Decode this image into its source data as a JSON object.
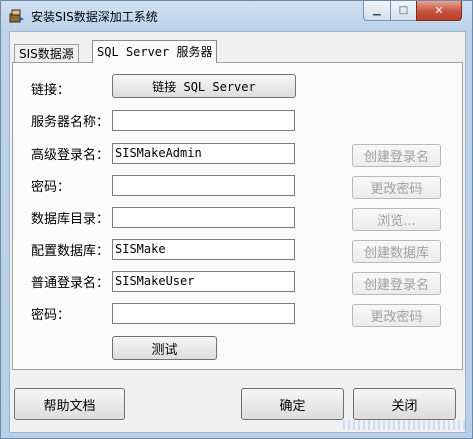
{
  "window": {
    "title": "安装SIS数据深加工系统",
    "minimize_glyph": "▁",
    "maximize_glyph": "□",
    "close_glyph": "✕"
  },
  "tabs": [
    {
      "label": "SIS数据源",
      "active": false
    },
    {
      "label": "SQL Server 服务器",
      "active": true
    }
  ],
  "form": {
    "link_label": "链接：",
    "link_button": "链接 SQL Server",
    "server_name_label": "服务器名称：",
    "server_name_value": "",
    "admin_login_label": "高级登录名：",
    "admin_login_value": "SISMakeAdmin",
    "admin_password_label": "密码：",
    "admin_password_value": "",
    "db_dir_label": "数据库目录：",
    "db_dir_value": "",
    "config_db_label": "配置数据库：",
    "config_db_value": "SISMake",
    "user_login_label": "普通登录名：",
    "user_login_value": "SISMakeUser",
    "user_password_label": "密码：",
    "user_password_value": "",
    "test_button": "测试"
  },
  "side_buttons": {
    "create_admin_login": "创建登录名",
    "change_admin_password": "更改密码",
    "browse": "浏览...",
    "create_database": "创建数据库",
    "create_user_login": "创建登录名",
    "change_user_password": "更改密码"
  },
  "footer": {
    "help_button": "帮助文档",
    "ok_button": "确定",
    "close_button": "关闭"
  },
  "icons": {
    "app": "installer-icon"
  },
  "colors": {
    "titlebar": "#bcd3ea",
    "close_button": "#c8513a",
    "panel": "#f0f0f0",
    "disabled_text": "#a0a0a0"
  }
}
